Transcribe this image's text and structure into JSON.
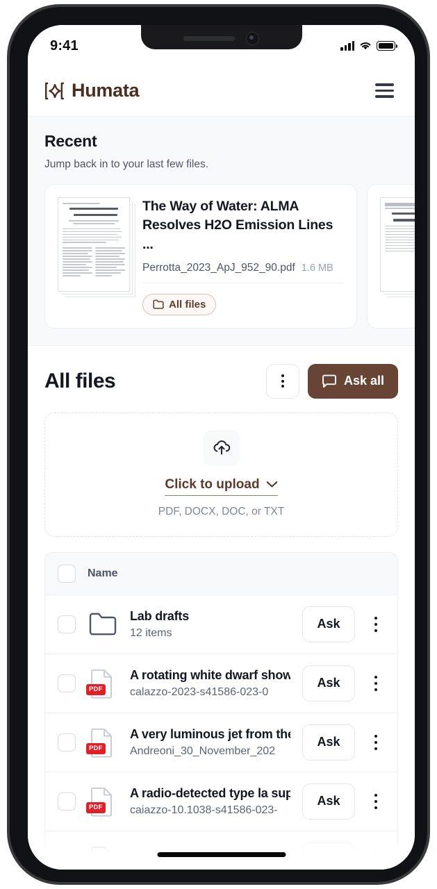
{
  "status_bar": {
    "time": "9:41",
    "signal_icon": "cellular-bars-icon",
    "wifi_icon": "wifi-icon",
    "battery_icon": "battery-icon"
  },
  "header": {
    "brand": "Humata",
    "logo_icon": "humata-diamond-logo-icon",
    "menu_icon": "hamburger-menu-icon"
  },
  "recent": {
    "title": "Recent",
    "subtitle": "Jump back in to your last few files.",
    "cards": [
      {
        "title": "The Way of Water: ALMA Resolves H2O Emission Lines ...",
        "filename": "Perrotta_2023_ApJ_952_90.pdf",
        "size": "1.6 MB",
        "chip_label": "All files",
        "chip_icon": "folder-icon"
      },
      {
        "title": "",
        "filename": "",
        "size": "",
        "chip_label": "",
        "chip_icon": "folder-icon"
      }
    ]
  },
  "all_files": {
    "title": "All files",
    "more_icon": "kebab-menu-icon",
    "ask_all_label": "Ask all",
    "ask_all_icon": "chat-bubble-icon",
    "ask_all_color": "#684434",
    "dropzone": {
      "upload_icon": "cloud-upload-icon",
      "label": "Click to upload",
      "chevron_icon": "chevron-down-icon",
      "hint": "PDF, DOCX, DOC, or TXT"
    },
    "table": {
      "header_checkbox": "select-all-checkbox",
      "column_name": "Name",
      "ask_label": "Ask",
      "row_menu_icon": "kebab-menu-icon",
      "rows": [
        {
          "type": "folder",
          "icon": "folder-icon",
          "name": "Lab drafts",
          "sub": "12 items"
        },
        {
          "type": "pdf",
          "icon": "pdf-file-icon",
          "badge": "PDF",
          "name": "A rotating white dwarf shows",
          "sub": "calazzo-2023-s41586-023-0"
        },
        {
          "type": "pdf",
          "icon": "pdf-file-icon",
          "badge": "PDF",
          "name": "A very luminous jet from the",
          "sub": "Andreoni_30_November_202"
        },
        {
          "type": "pdf",
          "icon": "pdf-file-icon",
          "badge": "PDF",
          "name": "A radio-detected type la sup",
          "sub": "caiazzo-10.1038-s41586-023-"
        }
      ]
    }
  }
}
